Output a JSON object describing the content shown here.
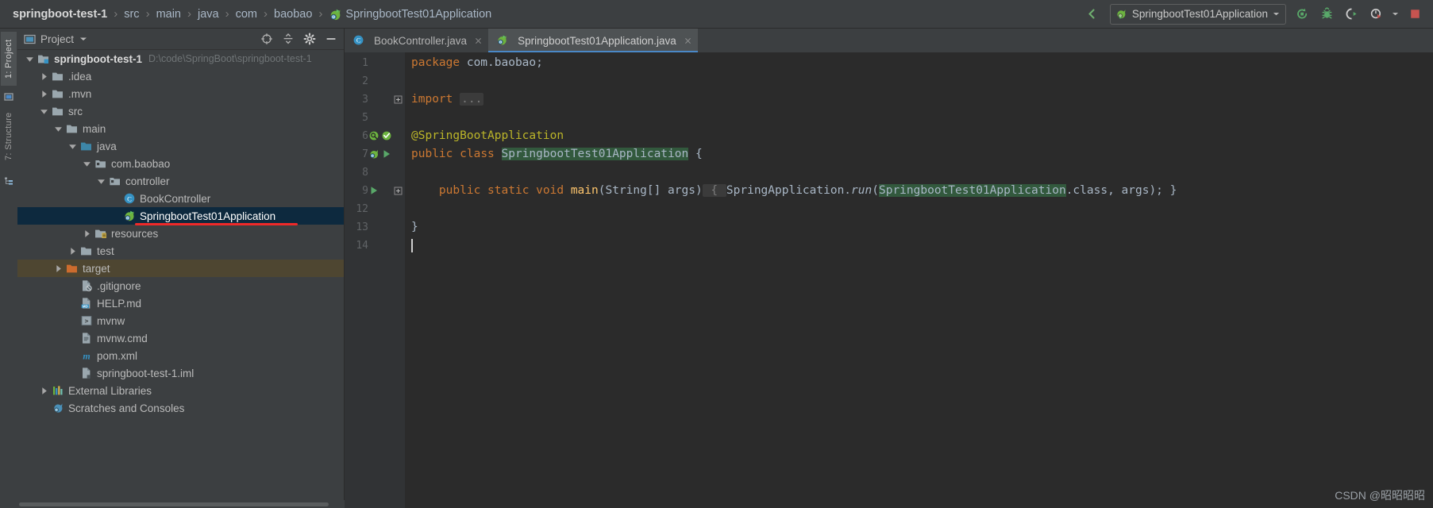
{
  "navbar": {
    "breadcrumbs": [
      {
        "label": "springboot-test-1",
        "icon": "",
        "bold": true
      },
      {
        "label": "src",
        "icon": "",
        "bold": false
      },
      {
        "label": "main",
        "icon": "",
        "bold": false
      },
      {
        "label": "java",
        "icon": "",
        "bold": false
      },
      {
        "label": "com",
        "icon": "",
        "bold": false
      },
      {
        "label": "baobao",
        "icon": "",
        "bold": false
      },
      {
        "label": "SpringbootTest01Application",
        "icon": "spring-class-icon",
        "bold": false
      }
    ],
    "separator": "›",
    "actions": {
      "back_arrow_icon": "back-arrow-icon",
      "run_config_name": "SpringbootTest01Application",
      "run_config_icon": "spring-boot-icon",
      "dropdown_icon": "chevron-down-icon",
      "rerun_icon": "rerun-icon",
      "debug_icon": "debug-icon",
      "run_with_coverage_icon": "coverage-icon",
      "profiler_icon": "profiler-icon",
      "profiler_dropdown_icon": "chevron-down-icon",
      "stop_icon": "stop-icon",
      "stop_color": "#c75450"
    }
  },
  "stripe": {
    "items": [
      {
        "label": "1: Project",
        "active": true
      },
      {
        "label": "7: Structure",
        "active": false
      }
    ]
  },
  "project_panel": {
    "icon": "project-window-icon",
    "title": "Project",
    "title_dropdown_icon": "chevron-down-icon",
    "actions": {
      "locate_icon": "crosshair-icon",
      "collapse_all_icon": "collapse-all-icon",
      "settings_icon": "gear-icon",
      "hide_icon": "minimize-icon"
    },
    "tree": [
      {
        "label": "springboot-test-1",
        "path": "D:\\code\\SpringBoot\\springboot-test-1",
        "depth": 0,
        "arrow": "down",
        "icon": "module-folder-icon",
        "bold": true,
        "state": "none"
      },
      {
        "label": ".idea",
        "path": "",
        "depth": 1,
        "arrow": "right",
        "icon": "folder-icon",
        "bold": false,
        "state": "none"
      },
      {
        "label": ".mvn",
        "path": "",
        "depth": 1,
        "arrow": "right",
        "icon": "folder-icon",
        "bold": false,
        "state": "none"
      },
      {
        "label": "src",
        "path": "",
        "depth": 1,
        "arrow": "down",
        "icon": "folder-icon",
        "bold": false,
        "state": "none"
      },
      {
        "label": "main",
        "path": "",
        "depth": 2,
        "arrow": "down",
        "icon": "folder-icon",
        "bold": false,
        "state": "none"
      },
      {
        "label": "java",
        "path": "",
        "depth": 3,
        "arrow": "down",
        "icon": "source-root-icon",
        "bold": false,
        "state": "none"
      },
      {
        "label": "com.baobao",
        "path": "",
        "depth": 4,
        "arrow": "down",
        "icon": "package-icon",
        "bold": false,
        "state": "none"
      },
      {
        "label": "controller",
        "path": "",
        "depth": 5,
        "arrow": "down",
        "icon": "package-icon",
        "bold": false,
        "state": "none"
      },
      {
        "label": "BookController",
        "path": "",
        "depth": 6,
        "arrow": "none",
        "icon": "java-class-icon",
        "bold": false,
        "state": "none"
      },
      {
        "label": "SpringbootTest01Application",
        "path": "",
        "depth": 6,
        "arrow": "none",
        "icon": "spring-class-icon",
        "bold": false,
        "state": "selected"
      },
      {
        "label": "resources",
        "path": "",
        "depth": 4,
        "arrow": "right",
        "icon": "resource-root-icon",
        "bold": false,
        "state": "none"
      },
      {
        "label": "test",
        "path": "",
        "depth": 3,
        "arrow": "right",
        "icon": "folder-icon",
        "bold": false,
        "state": "none"
      },
      {
        "label": "target",
        "path": "",
        "depth": 2,
        "arrow": "right",
        "icon": "excluded-folder-icon",
        "bold": false,
        "state": "highlighted"
      },
      {
        "label": ".gitignore",
        "path": "",
        "depth": 3,
        "arrow": "none",
        "icon": "gitignore-file-icon",
        "bold": false,
        "state": "none"
      },
      {
        "label": "HELP.md",
        "path": "",
        "depth": 3,
        "arrow": "none",
        "icon": "markdown-file-icon",
        "bold": false,
        "state": "none"
      },
      {
        "label": "mvnw",
        "path": "",
        "depth": 3,
        "arrow": "none",
        "icon": "shell-script-icon",
        "bold": false,
        "state": "none"
      },
      {
        "label": "mvnw.cmd",
        "path": "",
        "depth": 3,
        "arrow": "none",
        "icon": "text-file-icon",
        "bold": false,
        "state": "none"
      },
      {
        "label": "pom.xml",
        "path": "",
        "depth": 3,
        "arrow": "none",
        "icon": "maven-file-icon",
        "bold": false,
        "state": "none"
      },
      {
        "label": "springboot-test-1.iml",
        "path": "",
        "depth": 3,
        "arrow": "none",
        "icon": "iml-file-icon",
        "bold": false,
        "state": "none"
      },
      {
        "label": "External Libraries",
        "path": "",
        "depth": 1,
        "arrow": "right",
        "icon": "libraries-icon",
        "bold": false,
        "state": "none"
      },
      {
        "label": "Scratches and Consoles",
        "path": "",
        "depth": 1,
        "arrow": "none",
        "icon": "scratches-icon",
        "bold": false,
        "state": "none"
      }
    ],
    "annotation": {
      "type": "red-underline",
      "target": "SpringbootTest01Application",
      "color": "#ef2929"
    }
  },
  "editor": {
    "tabs": [
      {
        "label": "BookController.java",
        "icon": "java-class-icon",
        "active": false,
        "close_icon": "close-icon"
      },
      {
        "label": "SpringbootTest01Application.java",
        "icon": "spring-class-icon",
        "active": true,
        "close_icon": "close-icon"
      }
    ],
    "line_numbers": [
      "1",
      "2",
      "3",
      "5",
      "6",
      "7",
      "8",
      "9",
      "12",
      "13",
      "14"
    ],
    "gutter_marks": [
      {
        "line": "6",
        "icons": [
          "spring-bean-icon",
          "inspection-ok-icon"
        ]
      },
      {
        "line": "7",
        "icons": [
          "spring-boot-icon",
          "run-gutter-icon"
        ]
      },
      {
        "line": "9",
        "icons": [
          "run-gutter-icon"
        ]
      }
    ],
    "fold_markers": [
      {
        "line": "3",
        "type": "expand-plus"
      },
      {
        "line": "9",
        "type": "expand-plus"
      }
    ],
    "code_lines": [
      {
        "line": "1",
        "tokens": [
          {
            "t": "package",
            "c": "kw"
          },
          {
            "t": " com.baobao;",
            "c": "ident"
          }
        ]
      },
      {
        "line": "2",
        "tokens": []
      },
      {
        "line": "3",
        "tokens": [
          {
            "t": "import",
            "c": "kw"
          },
          {
            "t": " ",
            "c": "ident"
          },
          {
            "t": "...",
            "c": "foldbox"
          }
        ]
      },
      {
        "line": "5",
        "tokens": []
      },
      {
        "line": "6",
        "tokens": [
          {
            "t": "@SpringBootApplication",
            "c": "ann"
          }
        ]
      },
      {
        "line": "7",
        "tokens": [
          {
            "t": "public",
            "c": "kw"
          },
          {
            "t": " ",
            "c": "ident"
          },
          {
            "t": "class",
            "c": "kw"
          },
          {
            "t": " ",
            "c": "ident"
          },
          {
            "t": "SpringbootTest01Application",
            "c": "hlgreen"
          },
          {
            "t": " {",
            "c": "ident"
          }
        ]
      },
      {
        "line": "8",
        "tokens": []
      },
      {
        "line": "9",
        "tokens": [
          {
            "t": "    ",
            "c": "ident"
          },
          {
            "t": "public",
            "c": "kw"
          },
          {
            "t": " ",
            "c": "ident"
          },
          {
            "t": "static",
            "c": "kw"
          },
          {
            "t": " ",
            "c": "ident"
          },
          {
            "t": "void",
            "c": "kw"
          },
          {
            "t": " ",
            "c": "ident"
          },
          {
            "t": "main",
            "c": "meth"
          },
          {
            "t": "(String[] args)",
            "c": "ident"
          },
          {
            "t": " { ",
            "c": "foldbox"
          },
          {
            "t": "SpringApplication.",
            "c": "ident"
          },
          {
            "t": "run",
            "c": "it"
          },
          {
            "t": "(",
            "c": "ident"
          },
          {
            "t": "SpringbootTest01Application",
            "c": "hlgreen"
          },
          {
            "t": ".class, args); }",
            "c": "ident"
          }
        ]
      },
      {
        "line": "12",
        "tokens": []
      },
      {
        "line": "13",
        "tokens": [
          {
            "t": "}",
            "c": "ident"
          }
        ]
      },
      {
        "line": "14",
        "tokens": []
      }
    ],
    "caret_line": "14",
    "colors": {
      "background": "#2b2b2b",
      "gutter": "#313335",
      "keyword": "#cc7832",
      "annotation": "#bbb529",
      "method": "#ffc66d",
      "identifier": "#a9b7c6",
      "highlight_green": "#32593d",
      "tab_active": "#4e5254",
      "tab_underline": "#4a88c7"
    }
  },
  "watermark": {
    "text": "CSDN @昭昭昭昭"
  }
}
